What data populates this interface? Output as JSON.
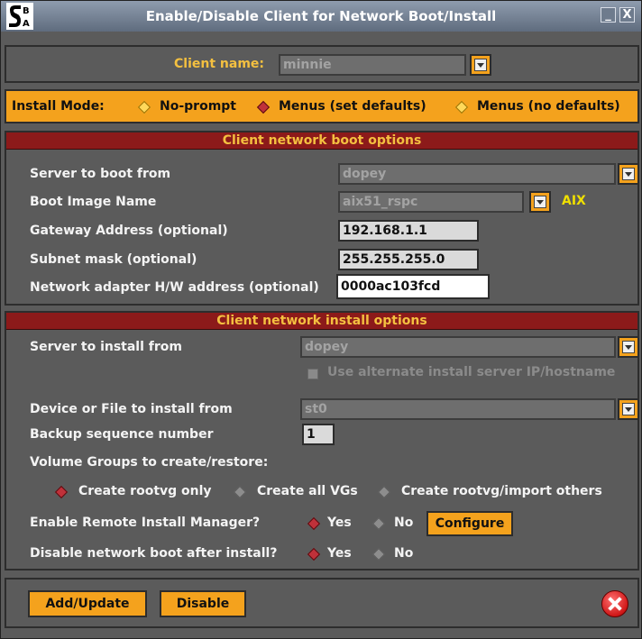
{
  "titlebar": {
    "title": "Enable/Disable Client for Network Boot/Install",
    "logo_icon": "sba-logo-icon",
    "minimize_glyph": "_",
    "close_glyph": "X"
  },
  "client": {
    "label": "Client name:",
    "value": "minnie"
  },
  "install_mode": {
    "label": "Install Mode:",
    "options": [
      {
        "label": "No-prompt",
        "selected": false
      },
      {
        "label": "Menus (set defaults)",
        "selected": true
      },
      {
        "label": "Menus (no defaults)",
        "selected": false
      }
    ]
  },
  "boot_options": {
    "header": "Client network boot options",
    "server_label": "Server to boot from",
    "server_value": "dopey",
    "image_label": "Boot Image Name",
    "image_value": "aix51_rspc",
    "image_os": "AIX",
    "gateway_label": "Gateway Address (optional)",
    "gateway_value": "192.168.1.1",
    "subnet_label": "Subnet mask (optional)",
    "subnet_value": "255.255.255.0",
    "hwaddr_label": "Network adapter H/W address (optional)",
    "hwaddr_value": "0000ac103fcd"
  },
  "install_options": {
    "header": "Client network install options",
    "server_label": "Server to install from",
    "server_value": "dopey",
    "alt_server_label": "Use alternate install server IP/hostname",
    "device_label": "Device or File to install from",
    "device_value": "st0",
    "backup_label": "Backup sequence number",
    "backup_value": "1",
    "vg_label": "Volume Groups to create/restore:",
    "vg_options": [
      {
        "label": "Create rootvg only",
        "selected": true
      },
      {
        "label": "Create all VGs",
        "selected": false
      },
      {
        "label": "Create rootvg/import others",
        "selected": false
      }
    ],
    "rim_label": "Enable Remote Install Manager?",
    "rim_yes": "Yes",
    "rim_no": "No",
    "rim_selected": "Yes",
    "configure_label": "Configure",
    "disable_label": "Disable network boot after install?",
    "disable_yes": "Yes",
    "disable_no": "No",
    "disable_selected": "Yes"
  },
  "footer": {
    "add_label": "Add/Update",
    "disable_label": "Disable"
  },
  "colors": {
    "accent": "#f4a21d",
    "header_bg": "#8c1a1a",
    "header_text": "#f4c040",
    "panel_bg": "#5b5b5b"
  }
}
